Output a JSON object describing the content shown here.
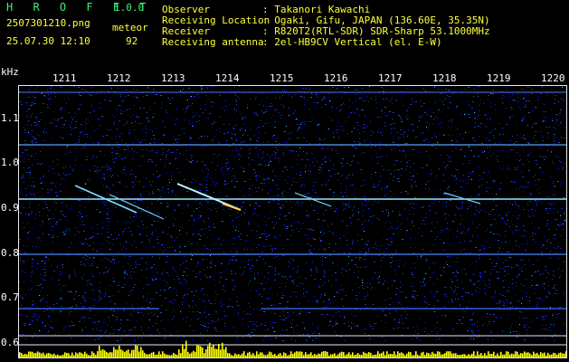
{
  "header": {
    "app_name": "H R O F F T",
    "version": "1.0.0",
    "filename": "2507301210.png",
    "mode": "meteor",
    "datetime": "25.07.30 12:10",
    "count": "92",
    "observer_label": "Observer",
    "observer_value": ": Takanori Kawachi",
    "location_label": "Receiving Location",
    "location_value": ": Ogaki, Gifu, JAPAN (136.60E, 35.35N)",
    "receiver_label": "Receiver",
    "receiver_value": ": R820T2(RTL-SDR) SDR-Sharp 53.1000MHz",
    "antenna_label": "Receiving antenna",
    "antenna_value": ": 2el-HB9CV Vertical (el. E-W)"
  },
  "axis": {
    "unit": "kHz",
    "time_ticks": [
      "1211",
      "1212",
      "1213",
      "1214",
      "1215",
      "1216",
      "1217",
      "1218",
      "1219",
      "1220"
    ],
    "freq_ticks": [
      "1.1",
      "1.0",
      "0.9",
      "0.8",
      "0.7",
      "0.6"
    ]
  },
  "colors": {
    "background": "#000000",
    "header_green": "#3df07a",
    "header_yellow": "#ffff3a",
    "noise": "#1c1cff",
    "signal": "#66e0ff",
    "amplitude_bars": "#ffff00"
  }
}
